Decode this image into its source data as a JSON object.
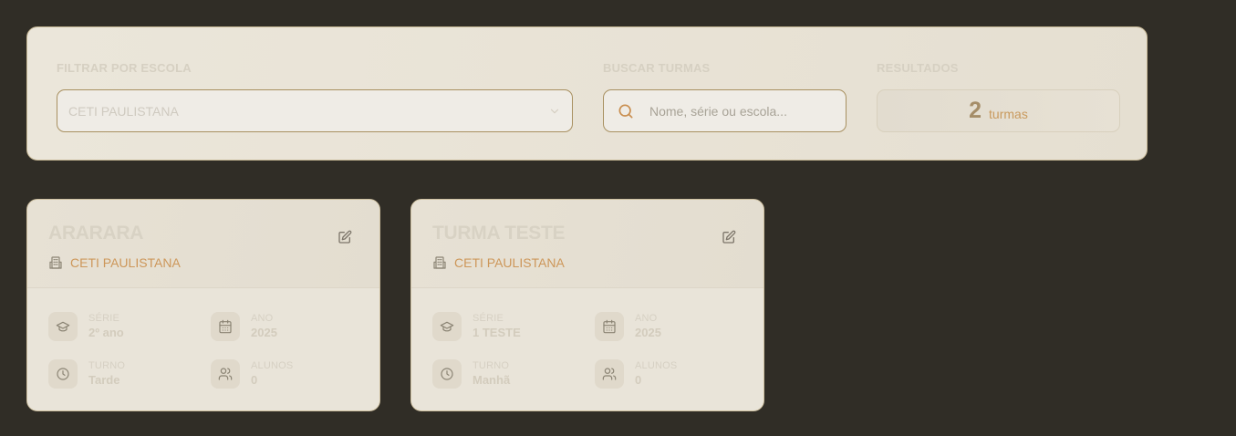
{
  "filters": {
    "school_label": "FILTRAR POR ESCOLA",
    "school_selected": "CETI PAULISTANA",
    "search_label": "BUSCAR TURMAS",
    "search_placeholder": "Nome, série ou escola...",
    "search_value": "",
    "results_label": "RESULTADOS",
    "results_count": "2",
    "results_unit": "turmas"
  },
  "classes": [
    {
      "name": "ARARARA",
      "school": "CETI PAULISTANA",
      "serie_label": "SÉRIE",
      "serie": "2º ano",
      "ano_label": "ANO",
      "ano": "2025",
      "turno_label": "TURNO",
      "turno": "Tarde",
      "alunos_label": "ALUNOS",
      "alunos": "0"
    },
    {
      "name": "TURMA TESTE",
      "school": "CETI PAULISTANA",
      "serie_label": "SÉRIE",
      "serie": "1 TESTE",
      "ano_label": "ANO",
      "ano": "2025",
      "turno_label": "TURNO",
      "turno": "Manhã",
      "alunos_label": "ALUNOS",
      "alunos": "0"
    }
  ],
  "colors": {
    "background": "#302d26",
    "panel": "#ebe6da",
    "accent": "#cd975a",
    "border": "#a89060"
  },
  "icons": {
    "select_chevron": "chevron-down-icon",
    "search": "search-icon",
    "edit": "edit-icon",
    "school": "building-icon",
    "serie": "graduation-cap-icon",
    "ano": "calendar-icon",
    "turno": "clock-icon",
    "alunos": "users-icon"
  }
}
